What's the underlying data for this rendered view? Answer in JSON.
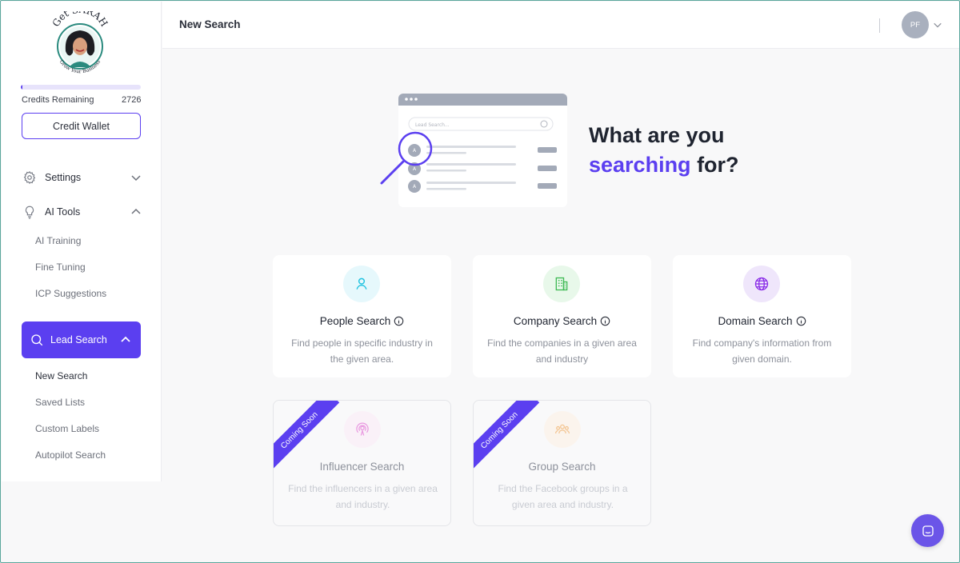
{
  "sidebar": {
    "logo": {
      "top_text": "Get SARAH",
      "bottom_text": "Grow Your Business"
    },
    "credits": {
      "label": "Credits Remaining",
      "value": "2726",
      "fill_fraction": 0.01
    },
    "credit_wallet_label": "Credit Wallet",
    "settings_label": "Settings",
    "ai_tools": {
      "label": "AI Tools",
      "items": [
        {
          "label": "AI Training"
        },
        {
          "label": "Fine Tuning"
        },
        {
          "label": "ICP Suggestions"
        }
      ]
    },
    "lead_search": {
      "label": "Lead Search",
      "items": [
        {
          "label": "New Search"
        },
        {
          "label": "Saved Lists"
        },
        {
          "label": "Custom Labels"
        },
        {
          "label": "Autopilot Search"
        }
      ]
    }
  },
  "header": {
    "title": "New Search",
    "avatar_initials": "PF"
  },
  "hero": {
    "line1": "What are you",
    "accent": "searching",
    "rest": " for?",
    "search_placeholder": "Lead Search...",
    "result_avatar": "A"
  },
  "cards": [
    {
      "title": "People Search",
      "desc": "Find people in specific industry in the given area.",
      "icon": "person-icon",
      "color": "#22c3e0",
      "bg": "#e6f8fc"
    },
    {
      "title": "Company Search",
      "desc": "Find the companies in a given area and industry",
      "icon": "building-icon",
      "color": "#3fba55",
      "bg": "#e8f8ea"
    },
    {
      "title": "Domain Search",
      "desc": "Find company's information from given domain.",
      "icon": "globe-icon",
      "color": "#8a2ce8",
      "bg": "#efe6fb"
    },
    {
      "title": "Influencer Search",
      "desc": "Find the influencers in a given area and industry.",
      "icon": "broadcast-icon",
      "color": "#e05bd0",
      "bg": "#fbecf8",
      "ribbon": "Coming Soon"
    },
    {
      "title": "Group Search",
      "desc": "Find the Facebook groups in a given area and industry.",
      "icon": "group-icon",
      "color": "#f0a14a",
      "bg": "#fdf2e6",
      "ribbon": "Coming Soon"
    }
  ],
  "colors": {
    "accent": "#5b3ff0",
    "chat": "#6b55e8"
  }
}
